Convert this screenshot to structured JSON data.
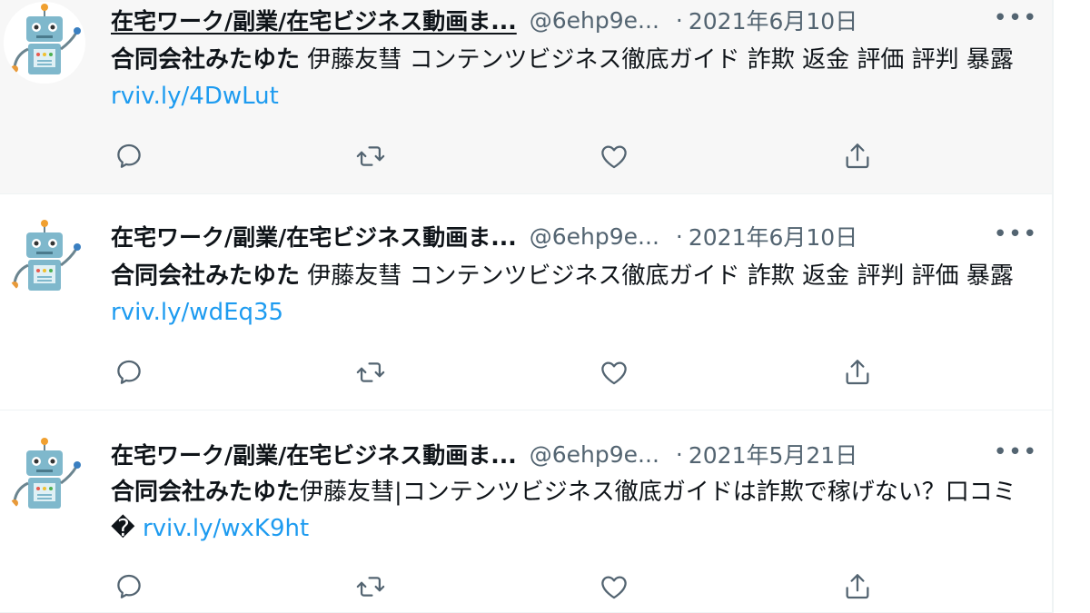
{
  "tweets": [
    {
      "display_name": "在宅ワーク/副業/在宅ビジネス動画ま...",
      "handle": "@6ehp9e...",
      "separator": "·",
      "date": "2021年6月10日",
      "more": "•••",
      "company": "合同会社みたゆた",
      "text": " 伊藤友彗 コンテンツビジネス徹底ガイド 詐欺 返金 評価 評判 暴露 ",
      "link": "rviv.ly/4DwLut",
      "hovered": true
    },
    {
      "display_name": "在宅ワーク/副業/在宅ビジネス動画ま...",
      "handle": "@6ehp9e...",
      "separator": "·",
      "date": "2021年6月10日",
      "more": "•••",
      "company": "合同会社みたゆた",
      "text": " 伊藤友彗 コンテンツビジネス徹底ガイド 詐欺 返金 評判 評価 暴露 ",
      "link": "rviv.ly/wdEq35",
      "hovered": false
    },
    {
      "display_name": "在宅ワーク/副業/在宅ビジネス動画ま...",
      "handle": "@6ehp9e...",
      "separator": "·",
      "date": "2021年5月21日",
      "more": "•••",
      "company": "合同会社みたゆた",
      "text": "伊藤友彗|コンテンツビジネス徹底ガイドは詐欺で稼げない？口コミ� ",
      "link": "rviv.ly/wxK9ht",
      "hovered": false
    }
  ],
  "icons": {
    "reply": "reply-icon",
    "retweet": "retweet-icon",
    "like": "heart-icon",
    "share": "share-icon",
    "more": "more-icon",
    "avatar": "robot-avatar-icon"
  },
  "colors": {
    "link": "#1d9bf0",
    "secondary": "#536471",
    "hover_bg": "#f7f7f7",
    "text": "#0f1419"
  }
}
